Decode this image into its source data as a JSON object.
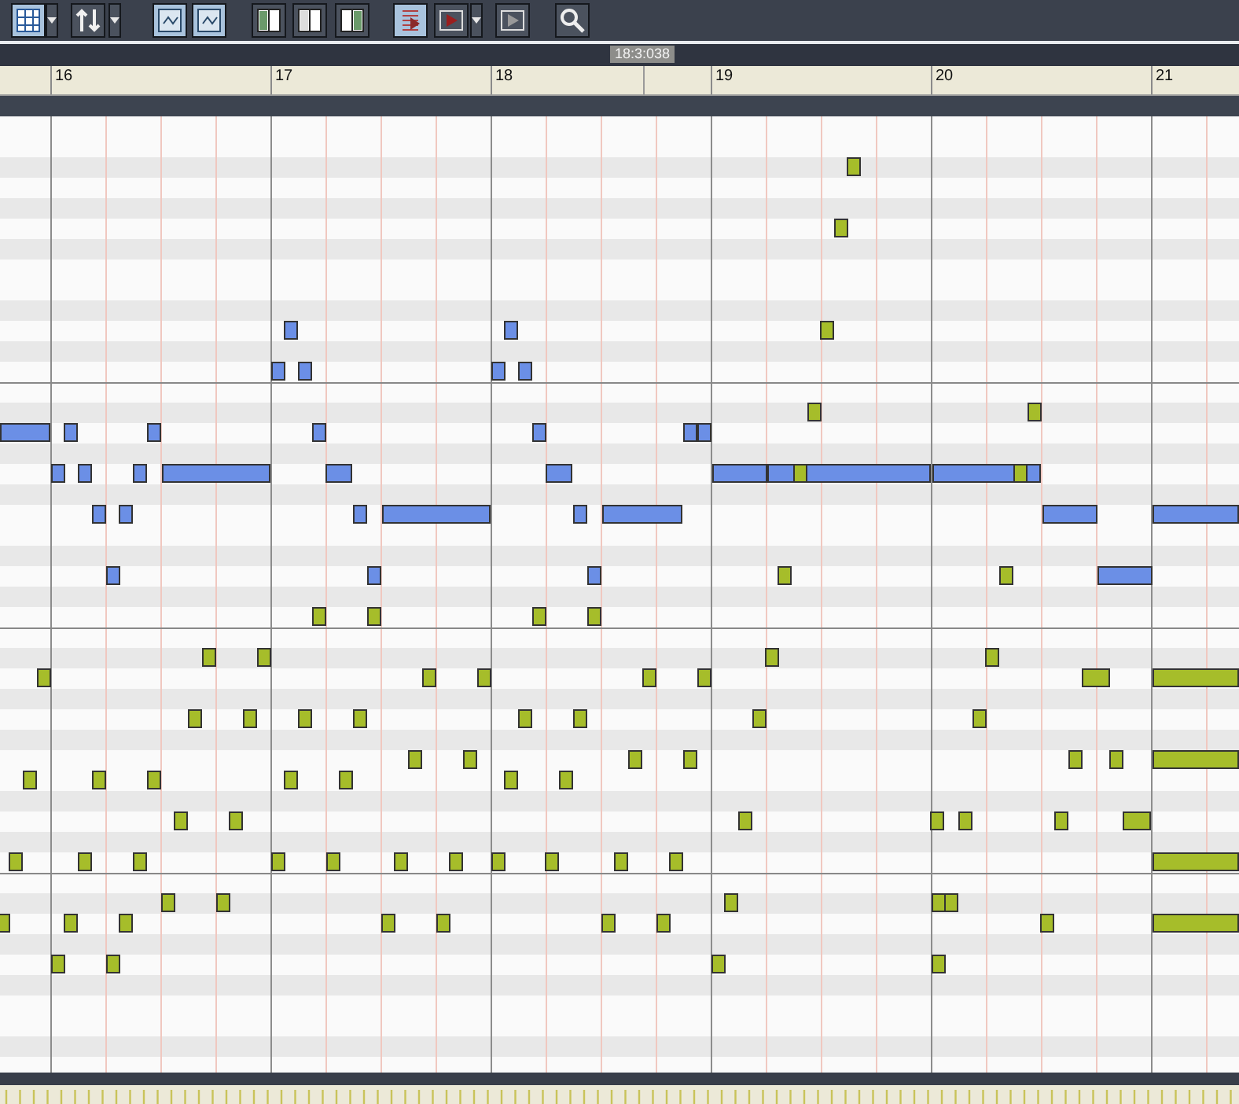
{
  "toolbar": [
    {
      "kind": "button",
      "selected": true
    },
    {
      "kind": "dropdown",
      "selected": false
    },
    {
      "kind": "button",
      "selected": false
    },
    {
      "kind": "dropdown",
      "selected": false
    },
    {
      "kind": "button",
      "selected": true
    },
    {
      "kind": "button",
      "selected": true
    },
    {
      "kind": "button",
      "selected": false
    },
    {
      "kind": "button",
      "selected": false
    },
    {
      "kind": "button",
      "selected": false
    },
    {
      "kind": "button",
      "selected": true
    },
    {
      "kind": "button",
      "selected": false
    },
    {
      "kind": "dropdown",
      "selected": false
    },
    {
      "kind": "button",
      "selected": false
    },
    {
      "kind": "button",
      "selected": false
    }
  ],
  "position_marker": "18:3:038",
  "ruler": {
    "bars": [
      "16",
      "17",
      "18",
      "19",
      "20",
      "21"
    ]
  },
  "note_tracks": [
    {
      "color": "#6b8fe6"
    },
    {
      "color": "#a6bd2a"
    }
  ]
}
